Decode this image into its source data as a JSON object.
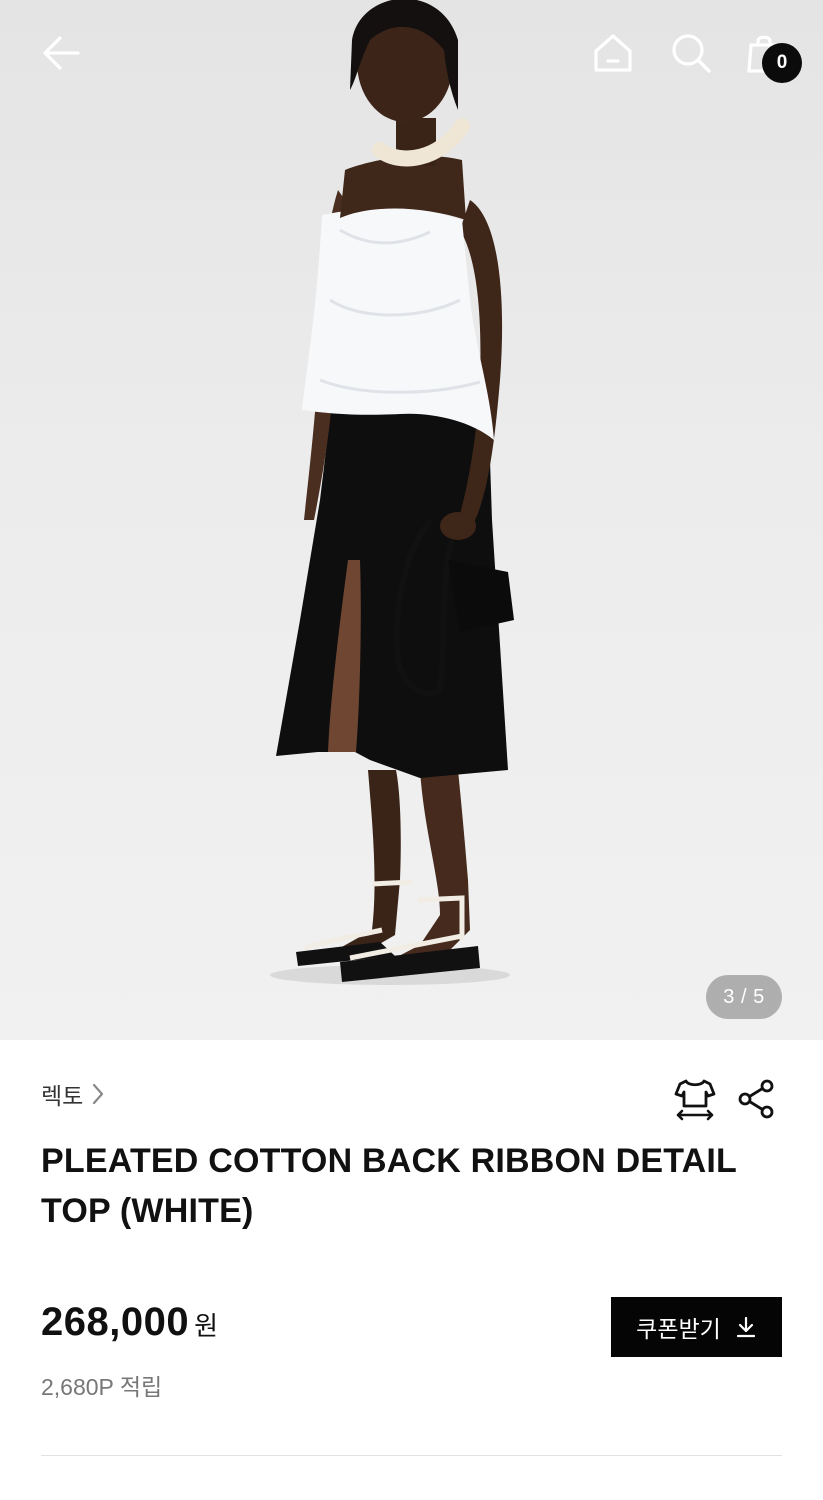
{
  "header": {
    "back_icon": "arrow-left-icon",
    "home_icon": "home-icon",
    "search_icon": "search-icon",
    "cart_icon": "shopping-bag-icon",
    "cart_count": "0"
  },
  "gallery": {
    "image_subject": "model-photo",
    "current_page": "3 / 5"
  },
  "product": {
    "brand": "렉토",
    "brand_chevron_icon": "chevron-right-icon",
    "size_icon": "size-guide-shirt-icon",
    "share_icon": "share-icon",
    "title": "PLEATED COTTON BACK RIBBON DETAIL TOP (WHITE)",
    "price": "268,000",
    "currency": "원",
    "points": "2,680P 적립",
    "coupon_label": "쿠폰받기",
    "coupon_icon": "download-icon"
  },
  "colors": {
    "primary_button": "#050505",
    "badge": "#0b0b0b"
  }
}
